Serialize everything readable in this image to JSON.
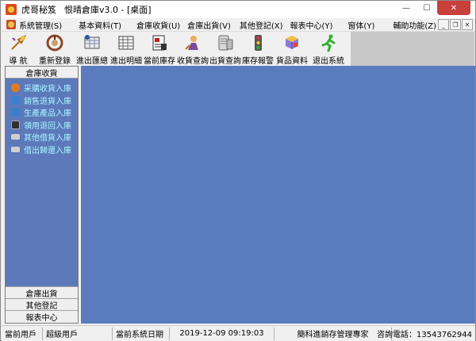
{
  "window": {
    "title_app": "虎哥秘笈",
    "title_main": "恨晴倉庫v3.0 - [桌面]",
    "controls": {
      "minimize": "—",
      "maximize": "☐",
      "close": "✕"
    }
  },
  "menubar": {
    "items": [
      {
        "label": "系統管理(S)"
      },
      {
        "label": "基本資料(T)"
      },
      {
        "label": "倉庫收貨(U)"
      },
      {
        "label": "倉庫出貨(V)"
      },
      {
        "label": "其他登記(X)"
      },
      {
        "label": "報表中心(Y)"
      },
      {
        "label": "窗体(Y)"
      },
      {
        "label": "輔助功能(Z)"
      }
    ],
    "mdi_controls": {
      "minimize": "_",
      "restore": "❐",
      "close": "✕"
    }
  },
  "toolbar": {
    "buttons": [
      {
        "label": "導 航",
        "icon": "navigate-icon",
        "color": "#e0a030"
      },
      {
        "label": "重新登錄",
        "icon": "relogin-icon",
        "color": "#a05030"
      },
      {
        "label": "進出匯總",
        "icon": "summary-icon",
        "color": "#3060a0"
      },
      {
        "label": "進出明細",
        "icon": "detail-icon",
        "color": "#505050"
      },
      {
        "label": "當前庫存",
        "icon": "inventory-icon",
        "color": "#c02020"
      },
      {
        "label": "收貨查詢",
        "icon": "receipt-query-icon",
        "color": "#d08020"
      },
      {
        "label": "出貨查詢",
        "icon": "shipment-query-icon",
        "color": "#707070"
      },
      {
        "label": "庫存報警",
        "icon": "traffic-light-icon",
        "color": "#30a040"
      },
      {
        "label": "貨品資料",
        "icon": "product-icon",
        "color": "#6060c0"
      },
      {
        "label": "退出系統",
        "icon": "exit-icon",
        "color": "#30b030"
      }
    ]
  },
  "leftpanel": {
    "header": "倉庫收貨",
    "items": [
      {
        "label": "采購收貨入庫",
        "icon": "purchase-icon",
        "color": "#e07a20"
      },
      {
        "label": "銷售退貨入庫",
        "icon": "sales-return-icon",
        "color": "#3a80d0"
      },
      {
        "label": "生產產品入庫",
        "icon": "production-icon",
        "color": "#3a80d0"
      },
      {
        "label": "領用退回入庫",
        "icon": "requisition-icon",
        "color": "#303030"
      },
      {
        "label": "其他借貨入庫",
        "icon": "borrow-icon",
        "color": "#d0d0d0"
      },
      {
        "label": "借出歸還入庫",
        "icon": "return-icon",
        "color": "#d0d0d0"
      }
    ],
    "footer": [
      "倉庫出貨",
      "其他登記",
      "報表中心"
    ]
  },
  "statusbar": {
    "user_label": "當前用戶",
    "user_value": "超級用戶",
    "date_label": "當前系統日期",
    "date_value": "2019-12-09 09:19:03",
    "product_name": "簡科進銷存管理專家",
    "phone": "咨詢電話：13543762944"
  },
  "colors": {
    "main_bg": "#5a7bbd",
    "panel_bg": "#5d79ba",
    "panel_text": "#a6f3ff"
  }
}
